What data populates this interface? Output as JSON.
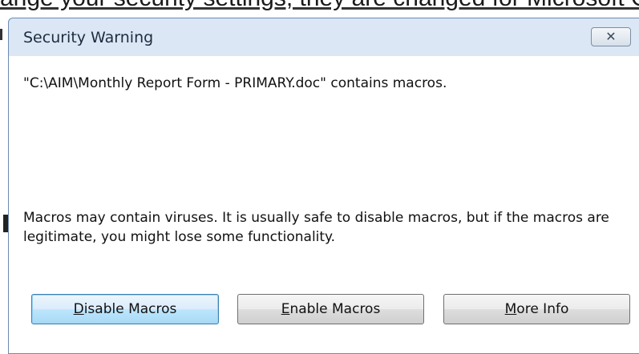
{
  "background": {
    "doc_text": "ange your security settings, they are changed for Microsoft O"
  },
  "dialog": {
    "title": "Security Warning",
    "close_glyph": "✕",
    "message_file": "\"C:\\AIM\\Monthly Report Form - PRIMARY.doc\" contains macros.",
    "message_warning": "Macros may contain viruses. It is usually safe to disable macros, but if the macros are legitimate, you might lose some functionality.",
    "buttons": {
      "disable": {
        "accel": "D",
        "rest": "isable Macros"
      },
      "enable": {
        "accel": "E",
        "rest": "nable Macros"
      },
      "more": {
        "accel": "M",
        "rest": "ore Info"
      }
    }
  }
}
